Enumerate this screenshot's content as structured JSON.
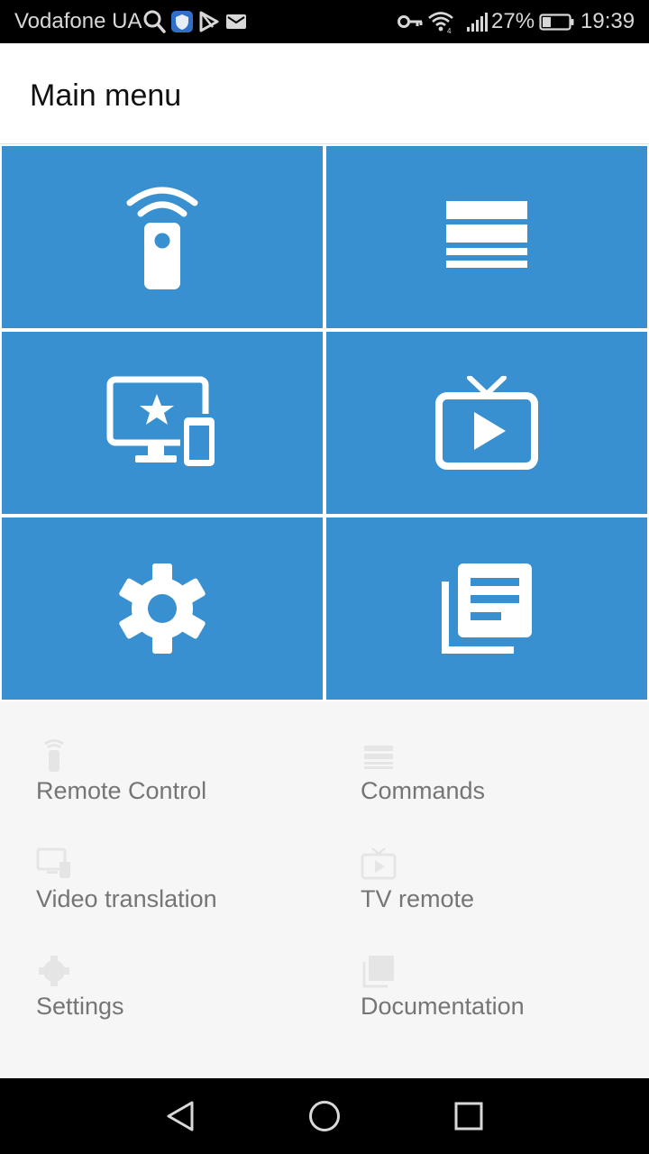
{
  "status_bar": {
    "carrier": "Vodafone UA",
    "battery_percent": "27%",
    "time": "19:39",
    "icons": [
      "search-icon",
      "vpn-shield-icon",
      "play-store-icon",
      "mail-icon",
      "key-icon",
      "wifi-icon",
      "signal-icon",
      "battery-icon"
    ]
  },
  "header": {
    "title": "Main menu"
  },
  "tiles": [
    {
      "icon": "remote-control-icon"
    },
    {
      "icon": "commands-list-icon"
    },
    {
      "icon": "screen-cast-icon"
    },
    {
      "icon": "tv-play-icon"
    },
    {
      "icon": "settings-gear-icon"
    },
    {
      "icon": "documentation-icon"
    }
  ],
  "menu": {
    "items": [
      {
        "label": "Remote Control",
        "icon": "remote-control-icon"
      },
      {
        "label": "Commands",
        "icon": "commands-list-icon"
      },
      {
        "label": "Video translation",
        "icon": "screen-cast-icon"
      },
      {
        "label": "TV remote",
        "icon": "tv-play-icon"
      },
      {
        "label": "Settings",
        "icon": "settings-gear-icon"
      },
      {
        "label": "Documentation",
        "icon": "documentation-icon"
      }
    ]
  },
  "nav_bar": {
    "icons": [
      "back-icon",
      "home-icon",
      "recents-icon"
    ]
  },
  "colors": {
    "tile_blue": "#3990d1",
    "status_bar": "#000000",
    "label_grey": "#757575",
    "list_bg": "#f6f6f6"
  }
}
